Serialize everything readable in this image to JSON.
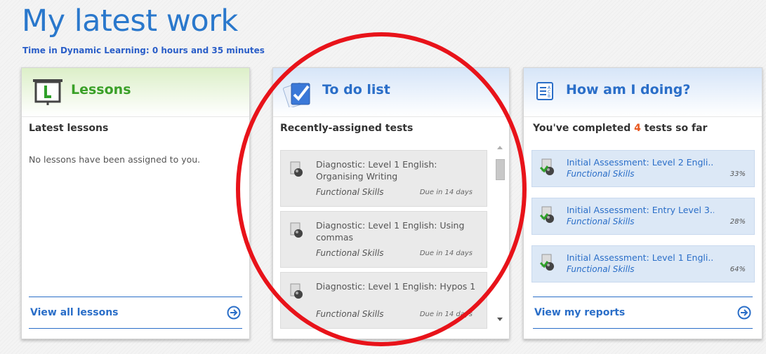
{
  "page": {
    "title": "My latest work",
    "time_line": "Time in Dynamic Learning: 0 hours and 35 minutes"
  },
  "lessons": {
    "title": "Lessons",
    "subhead": "Latest lessons",
    "empty_text": "No lessons have been assigned to you.",
    "footer_link": "View all lessons",
    "icon": "lesson-board-icon"
  },
  "todo": {
    "title": "To do list",
    "subhead": "Recently-assigned tests",
    "icon": "checklist-icon",
    "items": [
      {
        "title": "Diagnostic: Level 1 English: Organising Writing",
        "subject": "Functional Skills",
        "due": "Due in 14 days"
      },
      {
        "title": "Diagnostic: Level 1 English: Using commas",
        "subject": "Functional Skills",
        "due": "Due in 14 days"
      },
      {
        "title": "Diagnostic: Level 1 English: Hypos 1",
        "subject": "Functional Skills",
        "due": "Due in 14 days"
      }
    ]
  },
  "howami": {
    "title": "How am I doing?",
    "icon": "report-list-icon",
    "sofar_prefix": "You've completed ",
    "sofar_count": "4",
    "sofar_suffix": " tests so far",
    "items": [
      {
        "title": "Initial Assessment: Level 2 Engli...",
        "subject": "Functional Skills",
        "percent": "33%"
      },
      {
        "title": "Initial Assessment: Entry Level 3...",
        "subject": "Functional Skills",
        "percent": "28%"
      },
      {
        "title": "Initial Assessment: Level 1 Engli...",
        "subject": "Functional Skills",
        "percent": "64%"
      }
    ],
    "footer_link": "View my reports"
  },
  "colors": {
    "accent_blue": "#2a6ec8",
    "lessons_green": "#3aa028",
    "count_orange": "#e8571e",
    "annotation_red": "#e8131a"
  }
}
